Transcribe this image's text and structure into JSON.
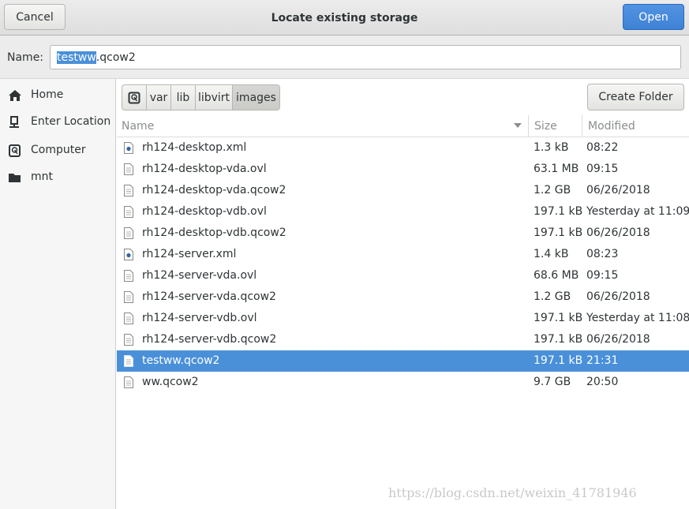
{
  "header": {
    "cancel_label": "Cancel",
    "title": "Locate existing storage",
    "open_label": "Open"
  },
  "name_row": {
    "label": "Name:",
    "value_selected": "testww",
    "value_rest": ".qcow2"
  },
  "sidebar": {
    "items": [
      {
        "label": "Home",
        "icon": "home-icon"
      },
      {
        "label": "Enter Location",
        "icon": "location-icon"
      },
      {
        "label": "Computer",
        "icon": "computer-icon"
      },
      {
        "label": "mnt",
        "icon": "folder-icon"
      }
    ]
  },
  "pathbar": {
    "crumbs": [
      "var",
      "lib",
      "libvirt",
      "images"
    ],
    "active": "images"
  },
  "toolbar": {
    "create_folder_label": "Create Folder"
  },
  "list": {
    "headers": {
      "name": "Name",
      "size": "Size",
      "modified": "Modified"
    },
    "files": [
      {
        "name": "rh124-desktop.xml",
        "size": "1.3 kB",
        "modified": "08:22",
        "icon": "xml-file-icon"
      },
      {
        "name": "rh124-desktop-vda.ovl",
        "size": "63.1 MB",
        "modified": "09:15",
        "icon": "file-icon"
      },
      {
        "name": "rh124-desktop-vda.qcow2",
        "size": "1.2 GB",
        "modified": "06/26/2018",
        "icon": "file-icon"
      },
      {
        "name": "rh124-desktop-vdb.ovl",
        "size": "197.1 kB",
        "modified": "Yesterday at 11:09",
        "icon": "file-icon"
      },
      {
        "name": "rh124-desktop-vdb.qcow2",
        "size": "197.1 kB",
        "modified": "06/26/2018",
        "icon": "file-icon"
      },
      {
        "name": "rh124-server.xml",
        "size": "1.4 kB",
        "modified": "08:23",
        "icon": "xml-file-icon"
      },
      {
        "name": "rh124-server-vda.ovl",
        "size": "68.6 MB",
        "modified": "09:15",
        "icon": "file-icon"
      },
      {
        "name": "rh124-server-vda.qcow2",
        "size": "1.2 GB",
        "modified": "06/26/2018",
        "icon": "file-icon"
      },
      {
        "name": "rh124-server-vdb.ovl",
        "size": "197.1 kB",
        "modified": "Yesterday at 11:08",
        "icon": "file-icon"
      },
      {
        "name": "rh124-server-vdb.qcow2",
        "size": "197.1 kB",
        "modified": "06/26/2018",
        "icon": "file-icon"
      },
      {
        "name": "testww.qcow2",
        "size": "197.1 kB",
        "modified": "21:31",
        "icon": "file-icon",
        "selected": true
      },
      {
        "name": "ww.qcow2",
        "size": "9.7 GB",
        "modified": "20:50",
        "icon": "file-icon"
      }
    ]
  },
  "watermark": "https://blog.csdn.net/weixin_41781946",
  "colors": {
    "accent": "#4a90d9",
    "open_button": "#3f81d4"
  }
}
